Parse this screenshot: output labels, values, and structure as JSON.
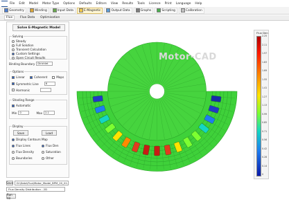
{
  "menu": [
    "File",
    "Edit",
    "Model",
    "Motor Type",
    "Options",
    "Defaults",
    "Editors",
    "View",
    "Results",
    "Tools",
    "Licence",
    "Print",
    "Language",
    "Help"
  ],
  "toolbar": [
    {
      "label": "Geometry",
      "color": "#4f7fd0"
    },
    {
      "label": "Winding",
      "color": "#d9a63a"
    },
    {
      "label": "Input Data",
      "color": "#6aa84f"
    },
    {
      "label": "E-Magnetic",
      "color": "#f2c94c",
      "active": true
    },
    {
      "label": "Output Data",
      "color": "#5b9bd5"
    },
    {
      "label": "Graphs",
      "color": "#7f7f7f"
    },
    {
      "label": "Scripting",
      "color": "#4caf50"
    },
    {
      "label": "Calibration",
      "color": "#c0c0c0"
    }
  ],
  "subtabs": [
    {
      "label": "Flux",
      "active": true
    },
    {
      "label": "Flux Data",
      "active": false
    },
    {
      "label": "Optimisation",
      "active": false
    }
  ],
  "panel": {
    "title": "Solve E-Magnetic Model",
    "group_solving": {
      "label": "Solving",
      "options": [
        {
          "label": "Steady",
          "on": false
        },
        {
          "label": "Full Solution",
          "on": false
        },
        {
          "label": "Transient Calculation",
          "on": false
        },
        {
          "label": "Custom Settings",
          "on": true
        },
        {
          "label": "Open Circuit Results",
          "on": false
        }
      ]
    },
    "binding_row": {
      "label": "Binding Boundary",
      "value": "Dirichlet"
    },
    "group_options": {
      "label": "Options",
      "row1": [
        {
          "label": "Linear",
          "on": true
        },
        {
          "label": "Coherent",
          "on": true
        },
        {
          "label": "Maps",
          "on": false
        }
      ],
      "row2": {
        "label": "Symmetric Line",
        "on": true,
        "value": "6"
      },
      "row3": {
        "label": "Harmonic",
        "on": false
      }
    },
    "group_shading": {
      "label": "Shading Range",
      "auto": {
        "label": "Automatic",
        "on": true
      },
      "min_label": "Min",
      "min_value": "0",
      "max_label": "Max",
      "max_value": "2.1"
    },
    "group_display": {
      "label": "Display",
      "btn_save": "Save",
      "btn_load": "Load",
      "col1": [
        {
          "label": "Display Contours",
          "on": true
        },
        {
          "label": "Flux Lines",
          "on": true
        },
        {
          "label": "Flux Density",
          "on": false
        },
        {
          "label": "Boundaries",
          "on": false
        }
      ],
      "col2_label": "Map",
      "col2": [
        {
          "label": "Flux Den",
          "on": true
        },
        {
          "label": "Saturation",
          "on": false
        },
        {
          "label": "Other",
          "on": false
        }
      ]
    }
  },
  "bottom": {
    "save_label": "Save",
    "file_value": "D:\\Data\\Flux\\Motor_Model_BPM_20_01.mot",
    "mode_value": "Flux Density Distribution - 2D",
    "run_label": "Run All"
  },
  "canvas": {
    "watermark": "Motor-CAD"
  },
  "scale": {
    "title": "Flux Den",
    "ticks": [
      "2.25",
      "2.11",
      "1.97",
      "1.83",
      "1.69",
      "1.55",
      "1.41",
      "1.27",
      "1.13",
      "0.99",
      "0.85",
      "0.71",
      "0.56",
      "0.42",
      "0.28",
      "0.14",
      "0"
    ]
  },
  "colors": {
    "stator": "#3fd13a",
    "rotor": "#46d43e",
    "magnet_red": "#e23a1f",
    "magnet_blue": "#2338c6"
  }
}
